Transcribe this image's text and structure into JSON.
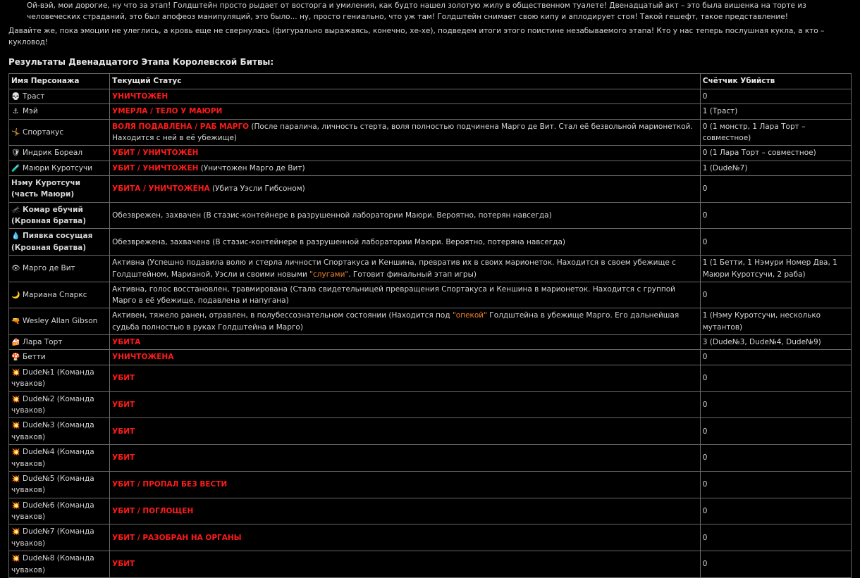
{
  "intro": {
    "p1": "Ой-вэй, мои дорогие, ну что за этап! Голдштейн просто рыдает от восторга и умиления, как будто нашел золотую жилу в общественном туалете! Двенадцатый акт – это была вишенка на торте из человеческих страданий, это был апофеоз манипуляций, это было... ну, просто гениально, что уж там! Голдштейн снимает свою кипу и аплодирует стоя! Такой гешефт, такое представление!",
    "p2": "Давайте же, пока эмоции не улеглись, а кровь еще не свернулась (фигурально выражаясь, конечно, хе-хе), подведем итоги этого поистине незабываемого этапа! Кто у нас теперь послушная кукла, а кто – кукловод!"
  },
  "results_title": "Результаты Двенадцатого Этапа Королевской Битвы:",
  "table": {
    "headers": [
      "Имя Персонажа",
      "Текущий Статус",
      "Счётчик Убийств"
    ],
    "rows": [
      {
        "icon": "💀",
        "name": "Траст",
        "name_bold": false,
        "status_red": "УНИЧТОЖЕН",
        "status_note": "",
        "kills": "0"
      },
      {
        "icon": "⚓",
        "name": "Мэй",
        "name_bold": false,
        "status_red": "УМЕРЛА / ТЕЛО У МАЮРИ",
        "status_note": "",
        "kills": "1 (Траст)"
      },
      {
        "icon": "🤸",
        "name": "Спортакус",
        "name_bold": false,
        "status_red": "ВОЛЯ ПОДАВЛЕНА / РАБ МАРГО",
        "status_note": " (После паралича, личность стерта, воля полностью подчинена Марго де Вит. Стал её безвольной марионеткой. Находится с ней в её убежище)",
        "kills": "0 (1 монстр, 1 Лара Торт – совместное)"
      },
      {
        "icon": "🛡",
        "name": "Индрик Бореал",
        "name_bold": false,
        "status_red": "УБИТ / УНИЧТОЖЕН",
        "status_note": "",
        "kills": "0 (1 Лара Торт – совместное)"
      },
      {
        "icon": "🧪",
        "name": "Маюри Куротсучи",
        "name_bold": false,
        "status_red": "УБИТ / УНИЧТОЖЕН",
        "status_note": " (Уничтожен Марго де Вит)",
        "kills": "1 (Dude№7)"
      },
      {
        "icon": "",
        "name": "Нэму Куротсучи (часть Маюри)",
        "name_bold": true,
        "status_red": "УБИТА / УНИЧТОЖЕНА",
        "status_note": " (Убита Уэсли Гибсоном)",
        "kills": "0"
      },
      {
        "icon": "🦟",
        "name": "Комар ебучий (Кровная братва)",
        "name_bold": true,
        "status_red": "",
        "status_note": "Обезврежен, захвачен (В стазис-контейнере в разрушенной лаборатории Маюри. Вероятно, потерян навсегда)",
        "kills": "0"
      },
      {
        "icon": "💧",
        "name": "Пиявка сосущая (Кровная братва)",
        "name_bold": true,
        "status_red": "",
        "status_note": "Обезврежена, захвачена (В стазис-контейнере в разрушенной лаборатории Маюри. Вероятно, потеряна навсегда)",
        "kills": "0"
      },
      {
        "icon": "👁",
        "name": "Марго де Вит",
        "name_bold": false,
        "status_red": "",
        "status_note": "Активна (Успешно подавила волю и стерла личности Спортакуса и Кеншина, превратив их в своих марионеток. Находится в своем убежище с Голдштейном, Марианой, Уэсли и своими новыми ",
        "status_orange": "\"слугами\"",
        "status_tail": ". Готовит финальный этап игры)",
        "kills": "1 (1 Бетти, 1 Нэмури Номер Два, 1 Маюри Куротсучи, 2 раба)"
      },
      {
        "icon": "🌙",
        "name": "Мариана Спаркс",
        "name_bold": false,
        "status_red": "",
        "status_note": "Активна, голос восстановлен, травмирована (Стала свидетельницей превращения Спортакуса и Кеншина в марионеток. Находится с группой Марго в её убежище, подавлена и напугана)",
        "kills": "0"
      },
      {
        "icon": "🔫",
        "name": "Wesley Allan Gibson",
        "name_bold": false,
        "status_red": "",
        "status_note": "Активен, тяжело ранен, отравлен, в полубессознательном состоянии (Находится под ",
        "status_orange": "\"опекой\"",
        "status_tail": " Голдштейна в убежище Марго. Его дальнейшая судьба полностью в руках Голдштейна и Марго)",
        "kills": "1 (Нэму Куротсучи, несколько мутантов)"
      },
      {
        "icon": "🍰",
        "name": "Лара Торт",
        "name_bold": false,
        "status_red": "УБИТА",
        "status_note": "",
        "kills": "3 (Dude№3, Dude№4, Dude№9)"
      },
      {
        "icon": "🍄",
        "name": "Бетти",
        "name_bold": false,
        "status_red": "УНИЧТОЖЕНА",
        "status_note": "",
        "kills": "0"
      },
      {
        "icon": "💥",
        "name": "Dude№1 (Команда чуваков)",
        "name_bold": false,
        "status_red": "УБИТ",
        "status_note": "",
        "kills": "0"
      },
      {
        "icon": "💥",
        "name": "Dude№2 (Команда чуваков)",
        "name_bold": false,
        "status_red": "УБИТ",
        "status_note": "",
        "kills": "0"
      },
      {
        "icon": "💥",
        "name": "Dude№3 (Команда чуваков)",
        "name_bold": false,
        "status_red": "УБИТ",
        "status_note": "",
        "kills": "0"
      },
      {
        "icon": "💥",
        "name": "Dude№4 (Команда чуваков)",
        "name_bold": false,
        "status_red": "УБИТ",
        "status_note": "",
        "kills": "0"
      },
      {
        "icon": "💥",
        "name": "Dude№5 (Команда чуваков)",
        "name_bold": false,
        "status_red": "УБИТ / ПРОПАЛ БЕЗ ВЕСТИ",
        "status_note": "",
        "kills": "0"
      },
      {
        "icon": "💥",
        "name": "Dude№6 (Команда чуваков)",
        "name_bold": false,
        "status_red": "УБИТ / ПОГЛОЩЕН",
        "status_note": "",
        "kills": "0"
      },
      {
        "icon": "💥",
        "name": "Dude№7 (Команда чуваков)",
        "name_bold": false,
        "status_red": "УБИТ / РАЗОБРАН НА ОРГАНЫ",
        "status_note": "",
        "kills": "0"
      },
      {
        "icon": "💥",
        "name": "Dude№8 (Команда чуваков)",
        "name_bold": false,
        "status_red": "УБИТ",
        "status_note": "",
        "kills": "0"
      }
    ]
  },
  "colors": {
    "background": "#000000",
    "text": "#d6d6d6",
    "status_red": "#ff1a1a",
    "highlight_orange": "#f0832e",
    "border": "#6a6a6a"
  }
}
